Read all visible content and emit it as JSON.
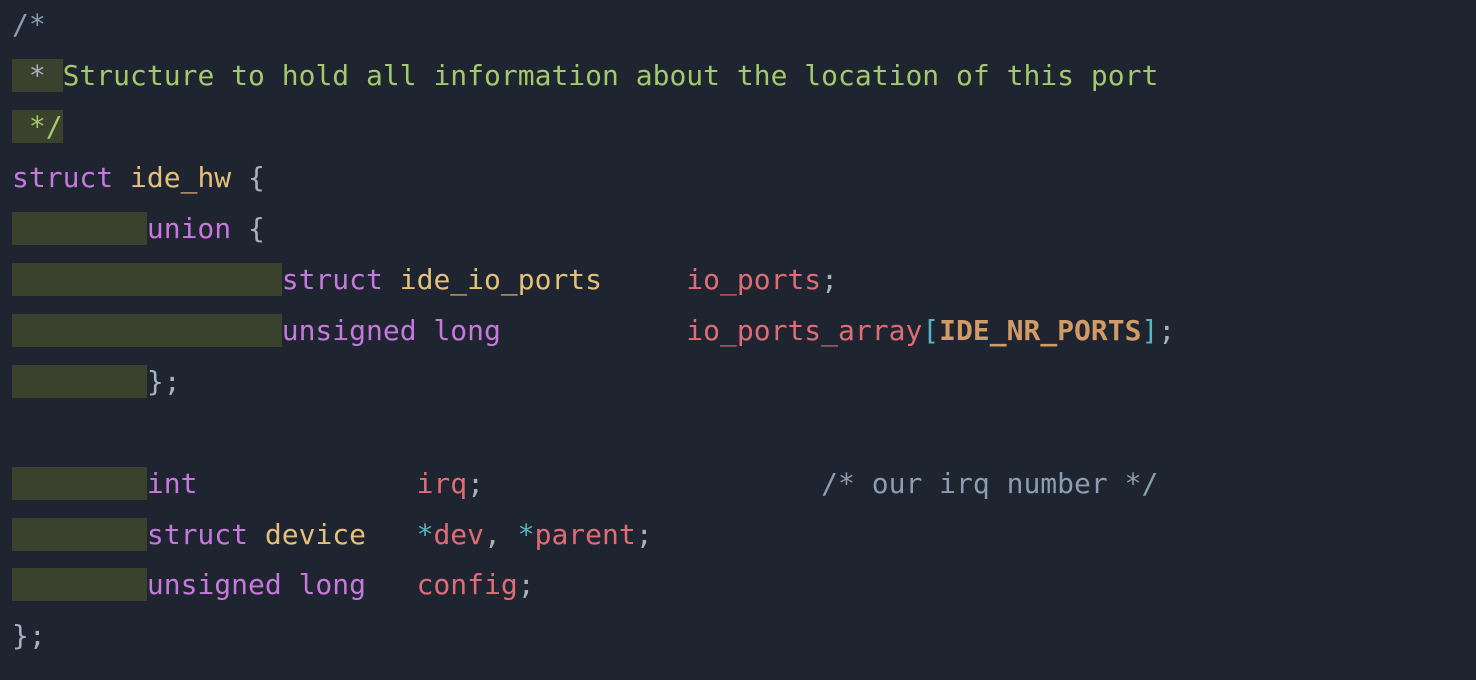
{
  "code": {
    "c1": "/*",
    "c2_pre": " * ",
    "c2_body": "Structure to hold all information about the location of this port",
    "c3": " */",
    "l4_kw": "struct",
    "l4_ty": "ide_hw",
    "l4_brace": " {",
    "indent1": "\t",
    "indent2": "\t\t",
    "l5_kw": "union",
    "l5_brace": " {",
    "l6_kw": "struct",
    "l6_ty": "ide_io_ports",
    "l6_id": "io_ports",
    "semi": ";",
    "l7_kw1": "unsigned",
    "l7_kw2": "long",
    "l7_pad": "\t",
    "l7_id": "io_ports_array",
    "l7_lb": "[",
    "l7_mac": "IDE_NR_PORTS",
    "l7_rb": "]",
    "l8_brace": "};",
    "l10_kw": "int",
    "l10_pad": "\t\t",
    "l10_id": "irq",
    "l10_cmtpad": "\t\t\t",
    "l10_cmt": "/* our irq number */",
    "l11_kw": "struct",
    "l11_ty": "device",
    "l11_pad": "\t",
    "l11_star": "*",
    "l11_id1": "dev",
    "l11_comma": ", ",
    "l11_id2": "parent",
    "l12_kw1": "unsigned",
    "l12_kw2": "long",
    "l12_pad": "\t",
    "l12_id": "config",
    "l13": "};"
  }
}
